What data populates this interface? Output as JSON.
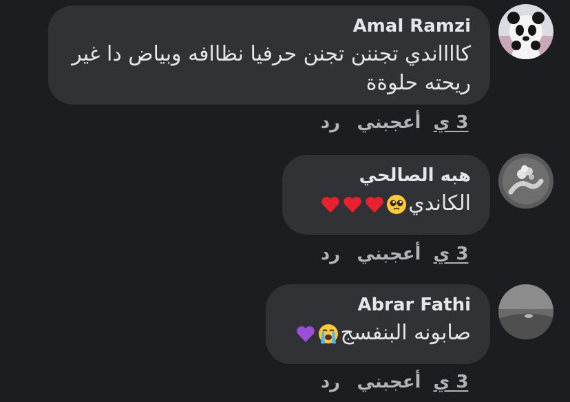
{
  "comments": [
    {
      "author": "Amal Ramzi",
      "text": "كااااندي تجننن تجنن حرفيا نظاافه وبياض  دا غير ريحته حلوةة",
      "emoji": [],
      "time": "3 ي",
      "like_label": "أعجبني",
      "reply_label": "رد"
    },
    {
      "author": "هبه الصالحي",
      "text": "الكاندي",
      "emoji": [
        "pleading-face",
        "red-heart",
        "red-heart",
        "red-heart"
      ],
      "time": "3 ي",
      "like_label": "أعجبني",
      "reply_label": "رد"
    },
    {
      "author": "Abrar Fathi",
      "text": "صابونه البنفسج",
      "emoji": [
        "loudly-crying-face",
        "purple-heart"
      ],
      "time": "3 ي",
      "like_label": "أعجبني",
      "reply_label": "رد"
    }
  ],
  "colors": {
    "background": "#1c1d20",
    "bubble": "#313236",
    "primary_text": "#e4e6eb",
    "secondary_text": "#b0b3b8",
    "red_heart": "#e8212e",
    "purple_heart": "#9b4fd9",
    "emoji_yellow": "#ffca3a"
  }
}
